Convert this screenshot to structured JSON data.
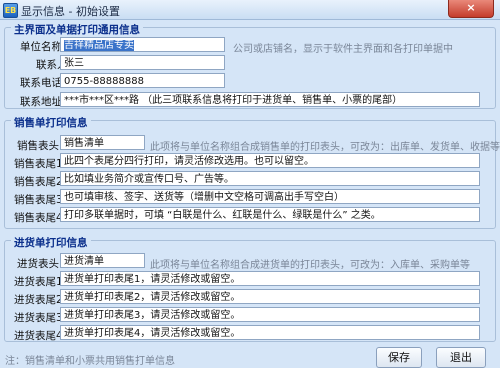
{
  "window": {
    "title": "显示信息 - 初始设置",
    "icon": "EB",
    "close_label": "×"
  },
  "main_section": {
    "title": "主界面及单据打印通用信息",
    "company": {
      "label": "单位名称",
      "value": "吉祥精品店专卖",
      "hint": "公司或店铺名，显示于软件主界面和各打印单据中"
    },
    "contact": {
      "label": "联系人",
      "value": "张三"
    },
    "phone": {
      "label": "联系电话",
      "value": "0755-88888888"
    },
    "address": {
      "label": "联系地址",
      "value": "***市***区***路  （此三项联系信息将打印于进货单、销售单、小票的尾部）"
    }
  },
  "sales_section": {
    "title": "销售单打印信息",
    "header": {
      "label": "销售表头",
      "value": "销售清单",
      "hint": "此项将与单位名称组合成销售单的打印表头，可改为：出库单、发货单、收据等"
    },
    "footers": [
      {
        "label": "销售表尾1",
        "value": "此四个表尾分四行打印，请灵活修改选用。也可以留空。"
      },
      {
        "label": "销售表尾2",
        "value": "比如填业务简介或宣传口号、广告等。"
      },
      {
        "label": "销售表尾3",
        "value": "也可填审核、签字、送货等（增删中文空格可调高出手写空白）"
      },
      {
        "label": "销售表尾4",
        "value": "打印多联单据时，可填 “白联是什么、红联是什么、绿联是什么” 之类。"
      }
    ]
  },
  "purchase_section": {
    "title": "进货单打印信息",
    "header": {
      "label": "进货表头",
      "value": "进货清单",
      "hint": "此项将与单位名称组合成进货单的打印表头，可改为：入库单、采购单等"
    },
    "footers": [
      {
        "label": "进货表尾1",
        "value": "进货单打印表尾1，请灵活修改或留空。"
      },
      {
        "label": "进货表尾2",
        "value": "进货单打印表尾2，请灵活修改或留空。"
      },
      {
        "label": "进货表尾3",
        "value": "进货单打印表尾3，请灵活修改或留空。"
      },
      {
        "label": "进货表尾4",
        "value": "进货单打印表尾4，请灵活修改或留空。"
      }
    ]
  },
  "footer": {
    "note": "注：销售清单和小票共用销售打单信息",
    "save_label": "保存",
    "exit_label": "退出"
  }
}
